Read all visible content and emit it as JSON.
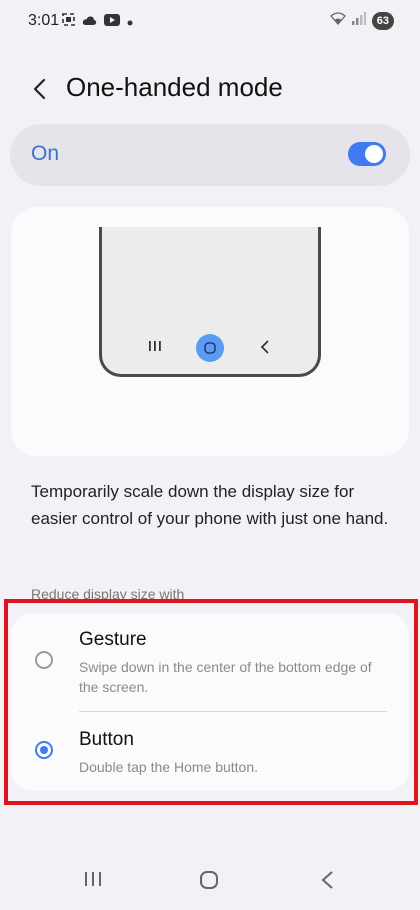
{
  "status_bar": {
    "time": "3:01",
    "battery": "63",
    "left_icons": [
      "screenshot-icon",
      "cloud-icon",
      "youtube-icon",
      "dot-icon"
    ],
    "right_icons": [
      "wifi-icon",
      "signal-icon",
      "battery-icon"
    ]
  },
  "header": {
    "title": "One-handed mode",
    "back_icon": "chevron-left-icon"
  },
  "master_switch": {
    "label": "On",
    "state": "on",
    "accent_color": "#3e7bf0"
  },
  "illustration": {
    "nav_icons": [
      "recents-icon",
      "home-icon",
      "back-icon"
    ],
    "home_color": "#5c9af3"
  },
  "description": "Temporarily scale down the display size for easier control of your phone with just one hand.",
  "section_label": "Reduce display size with",
  "options": [
    {
      "title": "Gesture",
      "subtitle": "Swipe down in the center of the bottom edge of the screen.",
      "selected": false
    },
    {
      "title": "Button",
      "subtitle": "Double tap the Home button.",
      "selected": true
    }
  ],
  "highlight_color": "#e0121e",
  "nav_bar": {
    "icons": [
      "recents-icon",
      "home-icon",
      "back-icon"
    ]
  }
}
